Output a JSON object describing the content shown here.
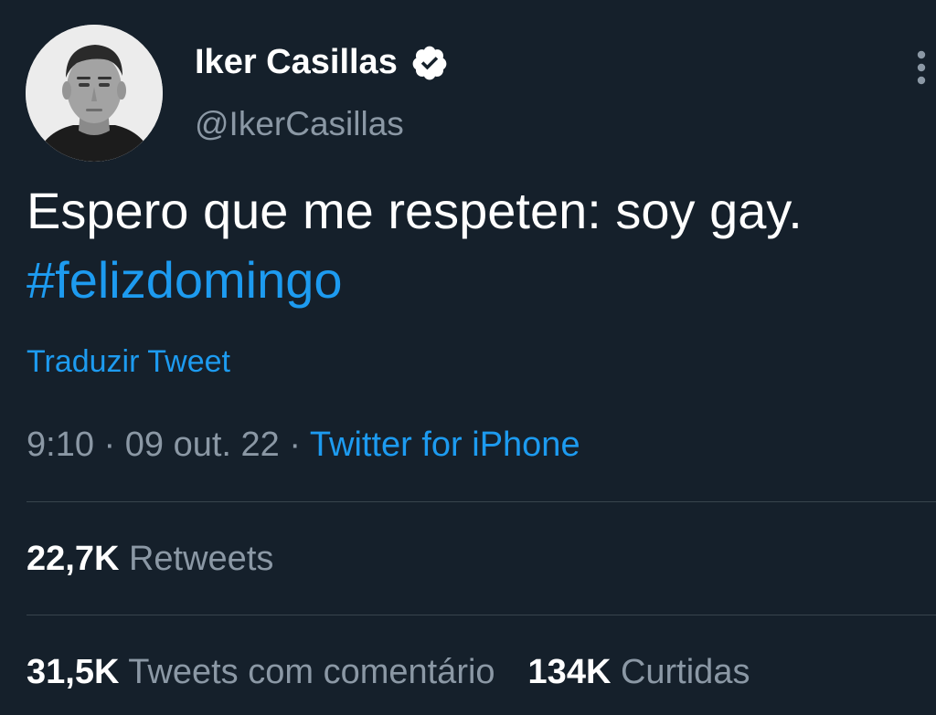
{
  "user": {
    "display_name": "Iker Casillas",
    "handle": "@IkerCasillas",
    "avatar_icon": "profile-photo",
    "verified_icon": "verified-badge-icon"
  },
  "tweet": {
    "text": "Espero que me respeten: soy gay.",
    "hashtag": "#felizdomingo",
    "translate_label": "Traduzir Tweet",
    "time": "9:10",
    "separator": "·",
    "date": "09 out. 22",
    "source": "Twitter for iPhone"
  },
  "stats": {
    "retweets_count": "22,7K",
    "retweets_label": "Retweets",
    "quotes_count": "31,5K",
    "quotes_label": "Tweets com comentário",
    "likes_count": "134K",
    "likes_label": "Curtidas"
  },
  "colors": {
    "background": "#15202b",
    "accent": "#1d9bf0",
    "secondary_text": "#8b98a5",
    "divider": "#38444d"
  }
}
